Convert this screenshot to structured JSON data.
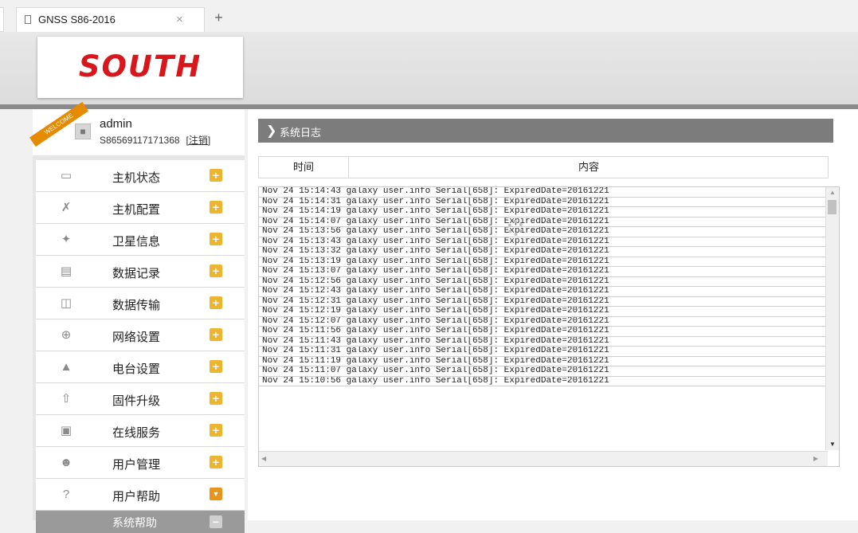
{
  "browser": {
    "tab_title": "GNSS S86-2016",
    "close_glyph": "×",
    "newtab_glyph": "+"
  },
  "header": {
    "logo_text": "SOUTH"
  },
  "user": {
    "ribbon": "WELCOME",
    "name": "admin",
    "device_id": "S86569117171368",
    "logout_label": "[注销]"
  },
  "menu": {
    "items": [
      {
        "label": "主机状态",
        "icon": "monitor-icon"
      },
      {
        "label": "主机配置",
        "icon": "tools-icon"
      },
      {
        "label": "卫星信息",
        "icon": "satellite-icon"
      },
      {
        "label": "数据记录",
        "icon": "calendar-icon"
      },
      {
        "label": "数据传输",
        "icon": "network-icon"
      },
      {
        "label": "网络设置",
        "icon": "globe-icon"
      },
      {
        "label": "电台设置",
        "icon": "radio-icon"
      },
      {
        "label": "固件升级",
        "icon": "upload-icon"
      },
      {
        "label": "在线服务",
        "icon": "box-icon"
      },
      {
        "label": "用户管理",
        "icon": "users-icon"
      },
      {
        "label": "用户帮助",
        "icon": "help-icon"
      }
    ],
    "sub_item": "系统帮助",
    "expand_glyph": "+",
    "collapse_glyph": "−"
  },
  "main": {
    "section_title": "系统日志",
    "col_time": "时间",
    "col_content": "内容"
  },
  "log_lines": [
    "Nov 24 15:14:43 galaxy user.info Serial[658]: ExpiredDate=20161221",
    "Nov 24 15:14:31 galaxy user.info Serial[658]: ExpiredDate=20161221",
    "Nov 24 15:14:19 galaxy user.info Serial[658]: ExpiredDate=20161221",
    "Nov 24 15:14:07 galaxy user.info Serial[658]: ExpiredDate=20161221",
    "Nov 24 15:13:56 galaxy user.info Serial[658]: ExpiredDate=20161221",
    "Nov 24 15:13:43 galaxy user.info Serial[658]: ExpiredDate=20161221",
    "Nov 24 15:13:32 galaxy user.info Serial[658]: ExpiredDate=20161221",
    "Nov 24 15:13:19 galaxy user.info Serial[658]: ExpiredDate=20161221",
    "Nov 24 15:13:07 galaxy user.info Serial[658]: ExpiredDate=20161221",
    "Nov 24 15:12:56 galaxy user.info Serial[658]: ExpiredDate=20161221",
    "Nov 24 15:12:43 galaxy user.info Serial[658]: ExpiredDate=20161221",
    "Nov 24 15:12:31 galaxy user.info Serial[658]: ExpiredDate=20161221",
    "Nov 24 15:12:19 galaxy user.info Serial[658]: ExpiredDate=20161221",
    "Nov 24 15:12:07 galaxy user.info Serial[658]: ExpiredDate=20161221",
    "Nov 24 15:11:56 galaxy user.info Serial[658]: ExpiredDate=20161221",
    "Nov 24 15:11:43 galaxy user.info Serial[658]: ExpiredDate=20161221",
    "Nov 24 15:11:31 galaxy user.info Serial[658]: ExpiredDate=20161221",
    "Nov 24 15:11:19 galaxy user.info Serial[658]: ExpiredDate=20161221",
    "Nov 24 15:11:07 galaxy user.info Serial[658]: ExpiredDate=20161221",
    "Nov 24 15:10:56 galaxy user.info Serial[658]: ExpiredDate=20161221"
  ]
}
